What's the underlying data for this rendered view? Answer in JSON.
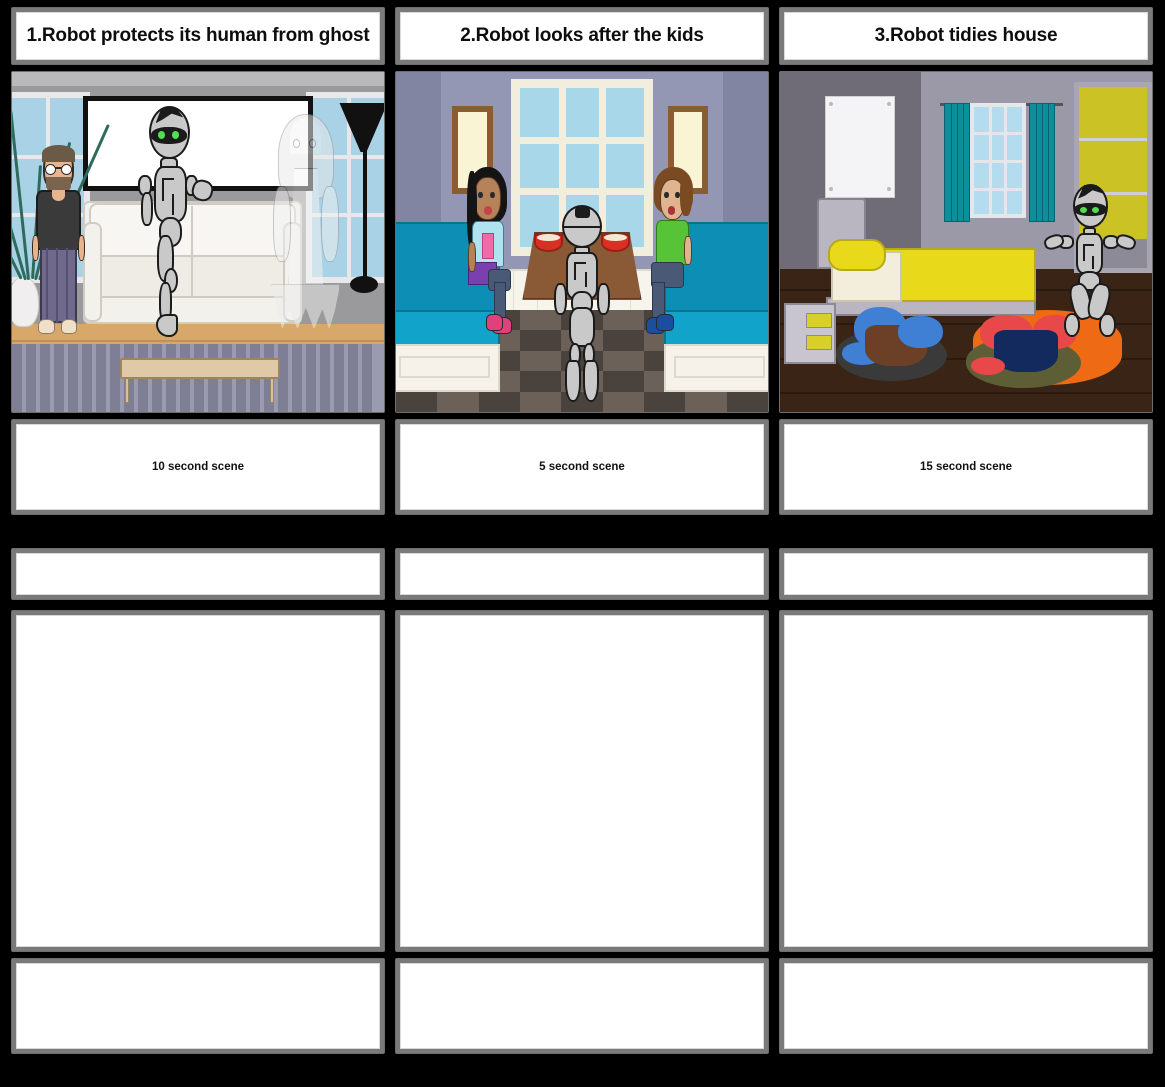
{
  "document": {
    "type": "storyboard",
    "background_color": "#000000",
    "cell_border_color": "#7a7a7a",
    "cell_fill_color": "#ffffff",
    "columns": 3,
    "blocks": 2
  },
  "block1": {
    "titles": [
      "1.Robot protects its human from ghost",
      "2.Robot looks after the kids",
      "3.Robot tidies house"
    ],
    "captions": [
      "10 second scene",
      "5 second scene",
      "15 second scene"
    ],
    "scenes": [
      {
        "id": "scene-1",
        "setting": "living room",
        "description": "Robot stands in front of a white sofa shielding a bearded man from a translucent ghost woman",
        "characters": [
          "man",
          "robot",
          "ghost"
        ],
        "objects": [
          "sofa",
          "coffee-table",
          "flat-screen-tv",
          "floor-lamp",
          "potted-plant",
          "striped-rug",
          "windows"
        ],
        "colors": {
          "wall": "#9a9a9c",
          "floor": "#d8a86a",
          "rug": "#9a9ab0",
          "sofa": "#f3f1ec",
          "table": "#e0c9a6",
          "robot_body": "#c9c9c9",
          "robot_eye": "#4fe04f",
          "man_shirt": "#3a3a3a",
          "man_pants": "#6f6a8c"
        }
      },
      {
        "id": "scene-2",
        "setting": "kitchen booth / diner",
        "description": "Robot stands between two children seated on teal booth benches at a brown table with two red bowls",
        "characters": [
          "girl",
          "boy",
          "robot"
        ],
        "objects": [
          "booth-bench-left",
          "booth-bench-right",
          "table",
          "red-bowl-left",
          "red-bowl-right",
          "window",
          "picture-frame-left",
          "picture-frame-right",
          "checkered-floor"
        ],
        "colors": {
          "wall": "#9497b4",
          "booth": "#11a3ca",
          "table": "#8a5a37",
          "bowl": "#d93025",
          "floor_dark": "#4a423c",
          "floor_light": "#6b6158",
          "girl_shirt": "#aee3ef",
          "girl_skirt": "#7b3fb0",
          "boy_shirt": "#56c436"
        }
      },
      {
        "id": "scene-3",
        "setting": "bedroom",
        "description": "Robot kneels on an orange rug beside two piles of laundry next to a yellow bed",
        "characters": [
          "robot"
        ],
        "objects": [
          "bed",
          "pillow",
          "nightstand",
          "poster",
          "curtained-window",
          "closet",
          "orange-rug",
          "laundry-pile-left",
          "laundry-pile-right"
        ],
        "colors": {
          "wall_left": "#6f6c78",
          "wall_right": "#9b98a8",
          "floor": "#3a2415",
          "bed": "#e9d91b",
          "rug": "#ee6a15",
          "curtain": "#0c8f9b",
          "closet": "#cbc226"
        }
      }
    ]
  },
  "block2": {
    "titles": [
      "",
      "",
      ""
    ],
    "captions": [
      "",
      "",
      ""
    ],
    "scenes": [
      {
        "id": "scene-4",
        "setting": "",
        "description": ""
      },
      {
        "id": "scene-5",
        "setting": "",
        "description": ""
      },
      {
        "id": "scene-6",
        "setting": "",
        "description": ""
      }
    ]
  }
}
